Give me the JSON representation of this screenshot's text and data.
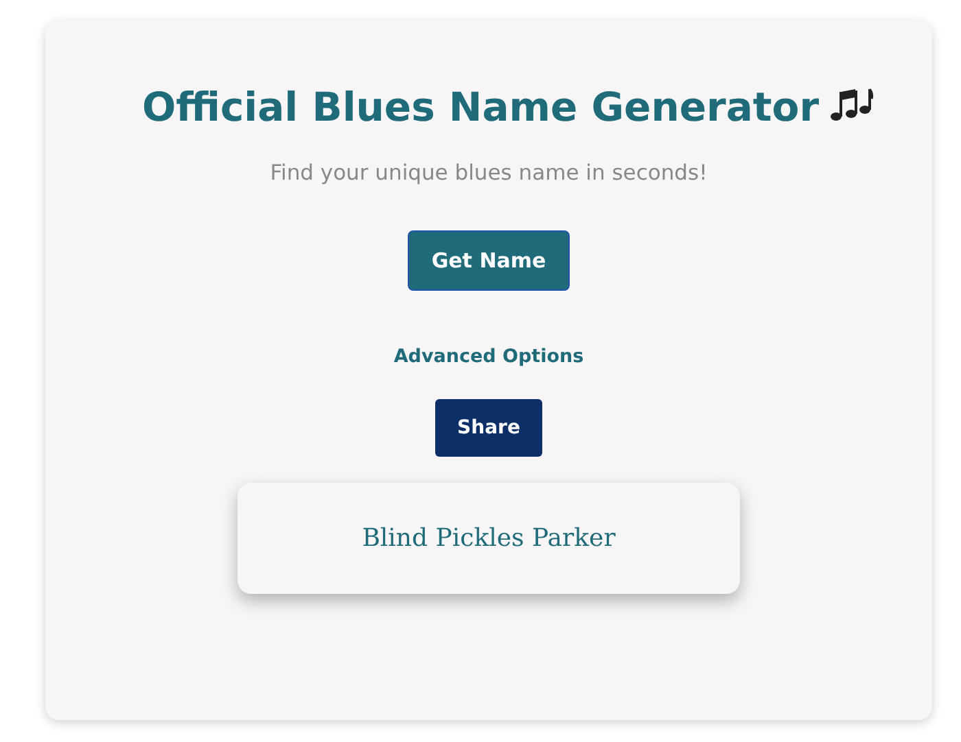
{
  "title": "Official Blues Name Generator",
  "subtitle": "Find your unique blues name in seconds!",
  "buttons": [
    {
      "label": "Get Name",
      "kind": "primary"
    },
    {
      "label": "Advanced Options",
      "kind": "link"
    },
    {
      "label": "Share",
      "kind": "share"
    }
  ],
  "result": {
    "name": "Blind Pickles Parker"
  }
}
